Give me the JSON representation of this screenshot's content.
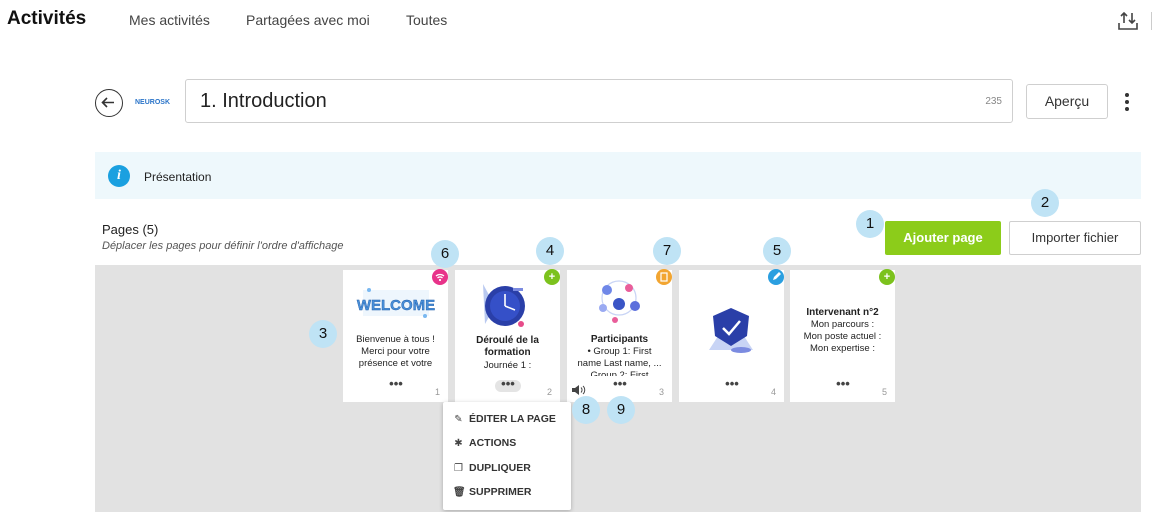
{
  "nav": {
    "title": "Activités",
    "tabs": [
      "Mes activités",
      "Partagées avec moi",
      "Toutes"
    ]
  },
  "header": {
    "logo_text": "NEUROSK",
    "title_value": "1. Introduction",
    "char_count": "235",
    "preview_label": "Aperçu"
  },
  "info": {
    "text": "Présentation"
  },
  "pages": {
    "title": "Pages (5)",
    "subtitle": "Déplacer les pages pour définir l'ordre d'affichage",
    "add_label": "Ajouter page",
    "import_label": "Importer fichier",
    "cards": [
      {
        "number": "1",
        "thumb_text": "WELCOME",
        "lines": [
          "Bienvenue à tous !",
          "Merci pour votre",
          "présence et votre"
        ],
        "badge_color": "#e8338a",
        "badge_icon": "wifi-icon"
      },
      {
        "number": "2",
        "heading": "Déroulé de la formation",
        "lines": [
          "Journée 1 :"
        ],
        "badge_color": "#7cc21d",
        "badge_icon": "plus-icon"
      },
      {
        "number": "3",
        "heading": "Participants",
        "lines": [
          "•  Group 1: First",
          "name Last name, ...",
          "Group 2: First"
        ],
        "badge_color": "#f2a531",
        "badge_icon": "document-icon"
      },
      {
        "number": "4",
        "lines": [],
        "badge_color": "#2b9fe0",
        "badge_icon": "pencil-icon"
      },
      {
        "number": "5",
        "heading": "Intervenant n°2",
        "lines": [
          "Mon parcours :",
          "Mon poste actuel :",
          "Mon expertise :"
        ],
        "badge_color": "#7cc21d",
        "badge_icon": "plus-icon"
      }
    ]
  },
  "menu": {
    "items": [
      {
        "label": "ÉDITER LA PAGE",
        "icon": "pencil-icon",
        "glyph": "✎"
      },
      {
        "label": "ACTIONS",
        "icon": "puzzle-icon",
        "glyph": "✱"
      },
      {
        "label": "DUPLIQUER",
        "icon": "copy-icon",
        "glyph": "❐"
      },
      {
        "label": "SUPPRIMER",
        "icon": "trash-icon",
        "glyph": "🗑"
      }
    ]
  },
  "callouts": [
    "1",
    "2",
    "3",
    "4",
    "5",
    "6",
    "7",
    "8",
    "9"
  ],
  "colors": {
    "accent_green": "#8ccc1a",
    "info_blue": "#1aa0e0",
    "callout_blue": "#bfe3f5"
  }
}
